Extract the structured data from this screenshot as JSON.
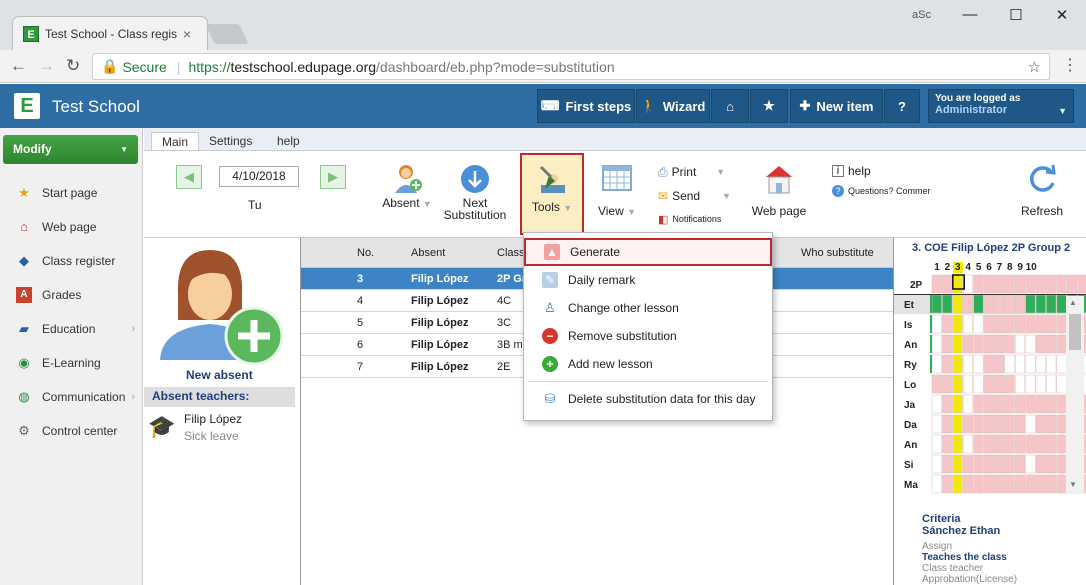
{
  "browser": {
    "tab_title": "Test School - Class regist",
    "tab_favicon": "E",
    "secure_label": "Secure",
    "url_prefix": "https://",
    "url_host": "testschool.edupage.org",
    "url_path": "/dashboard/eb.php?mode=substitution",
    "profile": "aSc"
  },
  "app": {
    "logo": "E",
    "name": "Test School",
    "buttons": [
      {
        "label": "First steps",
        "icon": "keyboard-icon"
      },
      {
        "label": "Wizard",
        "icon": "walking-icon"
      },
      {
        "label": "",
        "icon": "home-icon"
      },
      {
        "label": "",
        "icon": "star-icon"
      },
      {
        "label": "New item",
        "icon": "plus-icon"
      },
      {
        "label": "?",
        "icon": "help-icon"
      }
    ],
    "login_line1": "You are logged as",
    "login_line2": "Administrator"
  },
  "sidebar": {
    "modify_label": "Modify",
    "items": [
      {
        "label": "Start page",
        "icon": "star-icon"
      },
      {
        "label": "Web page",
        "icon": "school-icon"
      },
      {
        "label": "Class register",
        "icon": "book-icon"
      },
      {
        "label": "Grades",
        "icon": "grades-icon"
      },
      {
        "label": "Education",
        "icon": "education-icon",
        "chevron": "›"
      },
      {
        "label": "E-Learning",
        "icon": "globe-icon"
      },
      {
        "label": "Communication",
        "icon": "communication-icon",
        "chevron": "›"
      },
      {
        "label": "Control center",
        "icon": "gear-icon"
      }
    ]
  },
  "ribbon": {
    "tabs": [
      "Main",
      "Settings",
      "help"
    ],
    "date": "4/10/2018",
    "day": "Tu",
    "absent": "Absent",
    "next_line1": "Next",
    "next_line2": "Substitution",
    "tools": "Tools",
    "view": "View",
    "print": "Print",
    "send": "Send",
    "notifications": "Notifications",
    "webpage": "Web page",
    "help": "help",
    "questions": "Questions? Commer",
    "refresh": "Refresh"
  },
  "absent_panel": {
    "new_absent": "New absent",
    "header": "Absent teachers:",
    "teacher_name": "Filip López",
    "teacher_reason": "Sick leave"
  },
  "grid": {
    "headers": {
      "no": "No.",
      "absent": "Absent",
      "class": "Class",
      "who": "Who substitute"
    },
    "rows": [
      {
        "no": "3",
        "absent": "Filip López",
        "class": "2P Gr",
        "selected": true
      },
      {
        "no": "4",
        "absent": "Filip López",
        "class": "4C",
        "selected": false
      },
      {
        "no": "5",
        "absent": "Filip López",
        "class": "3C",
        "selected": false
      },
      {
        "no": "6",
        "absent": "Filip López",
        "class": "3B ma",
        "selected": false
      },
      {
        "no": "7",
        "absent": "Filip López",
        "class": "2E",
        "selected": false
      }
    ]
  },
  "menu": {
    "items": [
      {
        "label": "Generate",
        "icon": "generate-icon"
      },
      {
        "label": "Daily remark",
        "icon": "remark-icon"
      },
      {
        "label": "Change other lesson",
        "icon": "person-icon"
      },
      {
        "label": "Remove substitution",
        "icon": "minus-circle-icon"
      },
      {
        "label": "Add new lesson",
        "icon": "plus-circle-icon"
      },
      {
        "label": "Delete substitution data for this day",
        "icon": "delete-data-icon"
      }
    ]
  },
  "timetable": {
    "title": "3. COE Filip López 2P Group 2",
    "periods": [
      "1",
      "2",
      "3",
      "4",
      "5",
      "6",
      "7",
      "8",
      "9",
      "10"
    ],
    "rows": [
      "2P",
      "Et",
      "Is",
      "An",
      "Ry",
      "Lo",
      "Ja",
      "Da",
      "An",
      "Si",
      "Ma"
    ],
    "criteria": "Criteria",
    "criteria_name": "Sánchez Ethan",
    "assign": "Assign",
    "teaches": "Teaches the class",
    "class_teacher": "Class teacher",
    "approbation": "Approbation(License)"
  },
  "colors": {
    "header_blue": "#2f6ea5",
    "green": "#2d862d",
    "selected_row": "#3d84c6",
    "highlight_red": "#c0282f",
    "tt_pink": "#f6c5c8",
    "tt_green": "#2fae5a",
    "tt_yellow": "#f2ea00"
  }
}
